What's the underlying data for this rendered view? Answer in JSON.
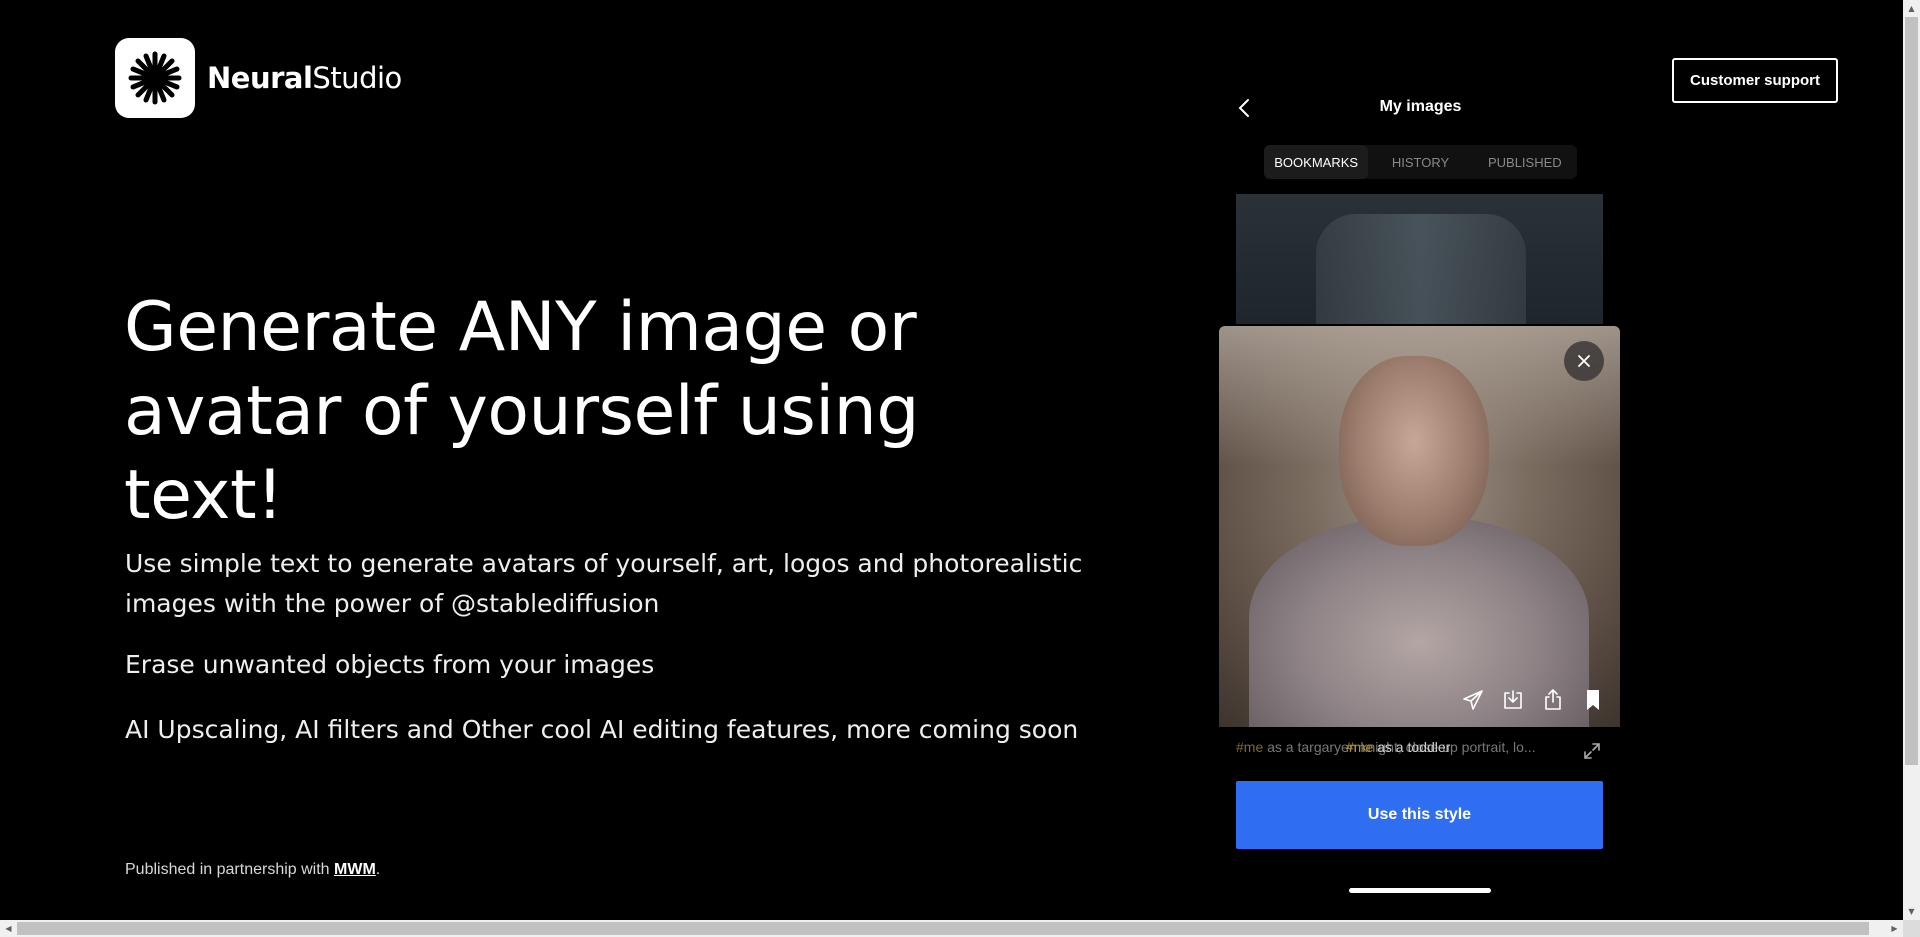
{
  "brand": {
    "name_bold": "Neural",
    "name_light": "Studio",
    "logo_icon": "starburst-icon"
  },
  "header": {
    "support_label": "Customer support"
  },
  "hero": {
    "title": "Generate ANY image or avatar of yourself using text!",
    "subtitle": "Use simple text to generate avatars of yourself, art, logos and photorealistic images with the power of @stablediffusion",
    "feature_erase": "Erase unwanted objects from your images",
    "feature_upscale": "AI Upscaling, AI filters and Other cool AI editing features, more coming soon"
  },
  "footer": {
    "prefix": "Published in partnership with ",
    "link_label": "MWM",
    "suffix": "."
  },
  "phone": {
    "title": "My images",
    "tabs": [
      {
        "label": "BOOKMARKS",
        "active": true
      },
      {
        "label": "HISTORY",
        "active": false
      },
      {
        "label": "PUBLISHED",
        "active": false
      }
    ],
    "prompt_tag": "#me",
    "prompt_text": " as a targaryen knight, close up portrait, lo...",
    "overlay_tag": "#me",
    "overlay_text": " as a toddler",
    "use_style_label": "Use this style",
    "modal_actions": [
      "send-icon",
      "download-icon",
      "share-icon",
      "bookmark-icon"
    ],
    "accent_color": "#2f6ef0"
  }
}
